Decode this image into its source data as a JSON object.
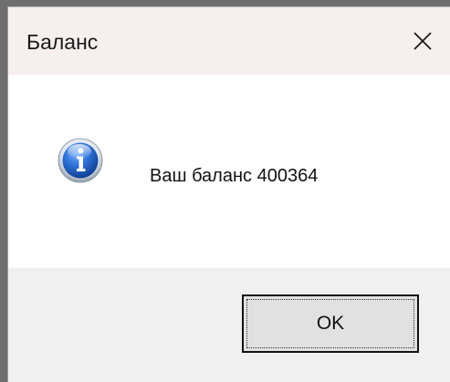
{
  "window": {
    "title": "Баланс"
  },
  "titlebar": {
    "close_icon": "close-icon"
  },
  "content": {
    "icon": "info-icon",
    "message": "Ваш баланс 400364"
  },
  "buttons": {
    "ok_label": "OK"
  },
  "colors": {
    "titlebar_bg": "#f7efee",
    "footer_bg": "#f0f0f0",
    "icon_blue": "#1e5fbf"
  }
}
